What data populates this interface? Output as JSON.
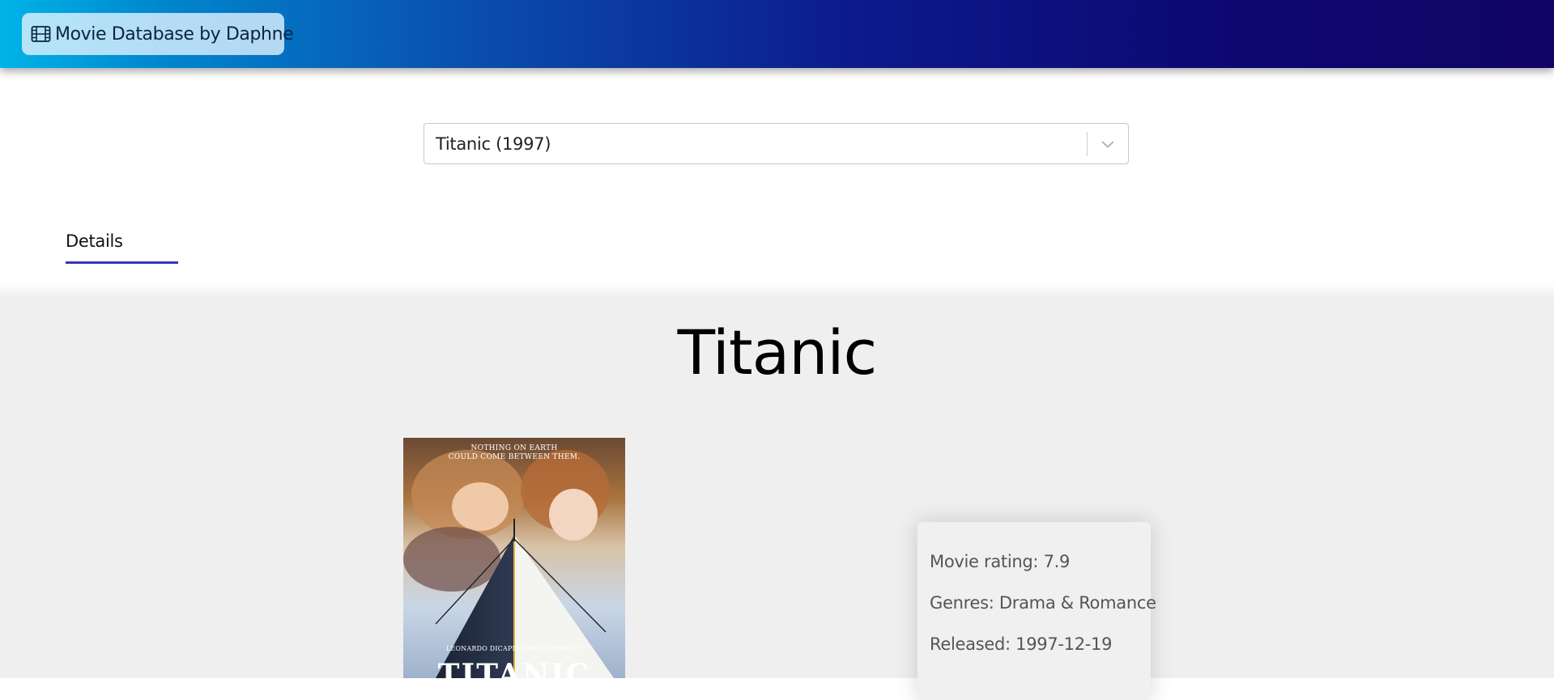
{
  "header": {
    "brand_title": "Movie Database by Daphne",
    "brand_icon": "film-icon",
    "gradient_colors": [
      "#00b4e8",
      "#0a4fae",
      "#100565"
    ]
  },
  "search": {
    "selected_value": "Titanic (1997)",
    "dropdown_icon": "chevron-down-icon"
  },
  "tabs": [
    {
      "label": "Details",
      "active": true,
      "accent": "#3b35b8"
    }
  ],
  "movie": {
    "title": "Titanic",
    "poster": {
      "tagline": "NOTHING ON EARTH COULD COME BETWEEN THEM.",
      "tagline_lines": [
        "NOTHING ON EARTH",
        "COULD COME BETWEEN THEM."
      ],
      "credits": "LEONARDO DICAPRIO   KATE WINSLET",
      "name": "TITANIC"
    },
    "info": {
      "rating": "Movie rating: 7.9",
      "genres": "Genres: Drama & Romance",
      "released": "Released: 1997-12-19"
    }
  }
}
